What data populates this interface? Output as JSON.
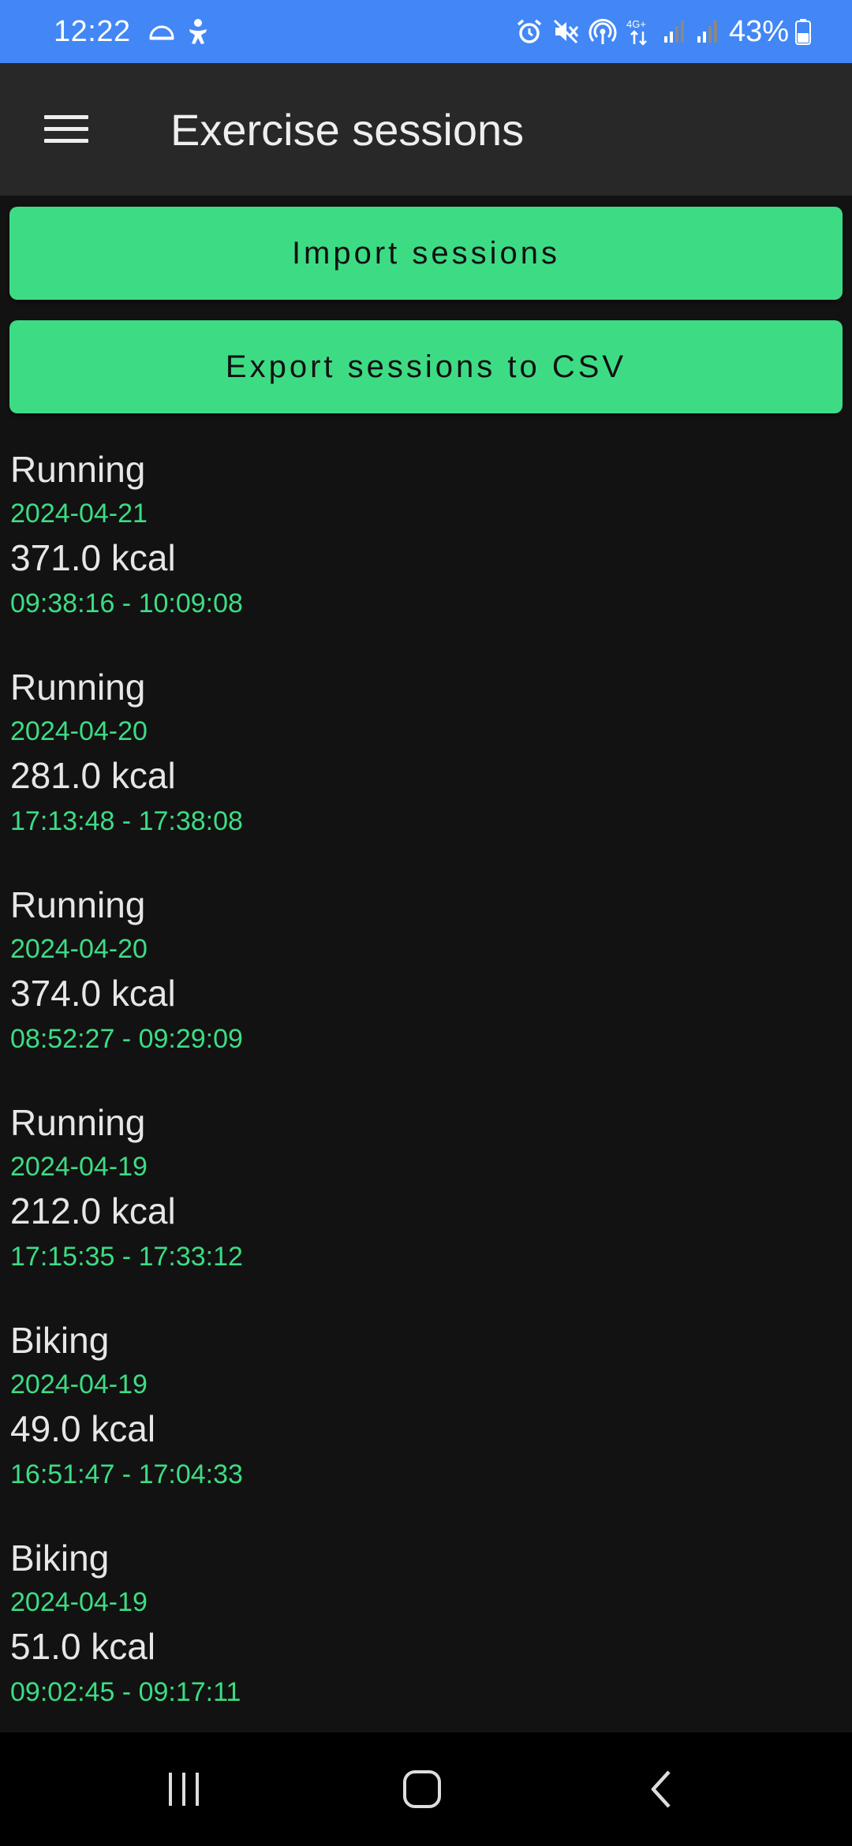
{
  "status_bar": {
    "time": "12:22",
    "battery": "43%",
    "left_icons": [
      "cloud-icon",
      "accessibility-icon"
    ],
    "right_icons": [
      "alarm-icon",
      "mute-icon",
      "hotspot-icon",
      "network-4g-icon",
      "signal-icon",
      "signal-icon",
      "battery-icon"
    ],
    "network_label": "4G+"
  },
  "app_bar": {
    "title": "Exercise sessions",
    "menu_icon": "hamburger-menu-icon"
  },
  "buttons": {
    "import_label": "Import sessions",
    "export_label": "Export sessions to CSV"
  },
  "sessions": [
    {
      "type": "Running",
      "date": "2024-04-21",
      "kcal": "371.0 kcal",
      "time": "09:38:16 - 10:09:08"
    },
    {
      "type": "Running",
      "date": "2024-04-20",
      "kcal": "281.0 kcal",
      "time": "17:13:48 - 17:38:08"
    },
    {
      "type": "Running",
      "date": "2024-04-20",
      "kcal": "374.0 kcal",
      "time": "08:52:27 - 09:29:09"
    },
    {
      "type": "Running",
      "date": "2024-04-19",
      "kcal": "212.0 kcal",
      "time": "17:15:35 - 17:33:12"
    },
    {
      "type": "Biking",
      "date": "2024-04-19",
      "kcal": "49.0 kcal",
      "time": "16:51:47 - 17:04:33"
    },
    {
      "type": "Biking",
      "date": "2024-04-19",
      "kcal": "51.0 kcal",
      "time": "09:02:45 - 09:17:11"
    }
  ],
  "colors": {
    "status_bar": "#4287f5",
    "app_bar": "#282828",
    "background": "#121212",
    "accent": "#3ddc84",
    "nav_bar": "#000000"
  },
  "nav_bar": {
    "icons": [
      "recents-icon",
      "home-icon",
      "back-icon"
    ]
  }
}
